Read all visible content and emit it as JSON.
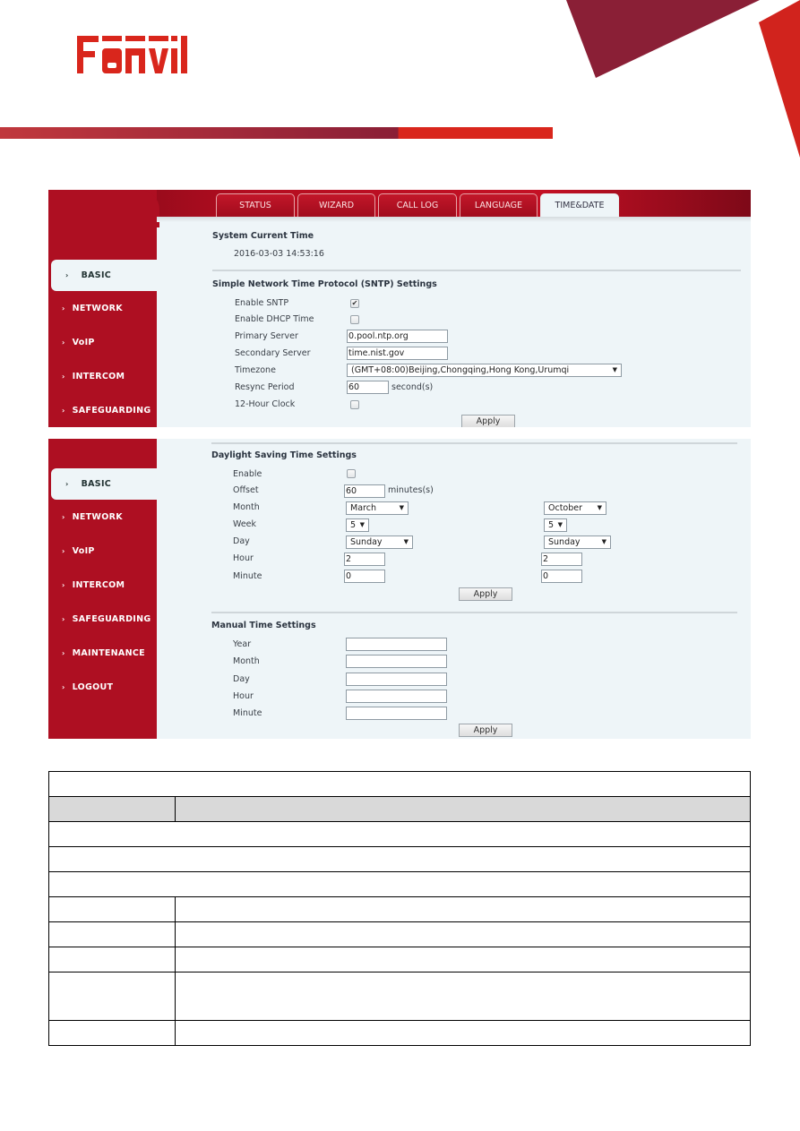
{
  "brand": {
    "logo_text": "Fanvil",
    "accent_red": "#d9261c",
    "accent_wine": "#8a1f36",
    "ui_red": "#ae0f22"
  },
  "panel1": {
    "tabs": [
      {
        "label": "STATUS",
        "active": false
      },
      {
        "label": "WIZARD",
        "active": false
      },
      {
        "label": "CALL LOG",
        "active": false
      },
      {
        "label": "LANGUAGE",
        "active": false
      },
      {
        "label": "TIME&DATE",
        "active": true
      }
    ],
    "nav": [
      {
        "label": "BASIC",
        "active": true
      },
      {
        "label": "NETWORK",
        "active": false
      },
      {
        "label": "VoIP",
        "active": false
      },
      {
        "label": "INTERCOM",
        "active": false
      },
      {
        "label": "SAFEGUARDING",
        "active": false
      }
    ],
    "system_time": {
      "title": "System Current Time",
      "value": "2016-03-03 14:53:16"
    },
    "sntp": {
      "title": "Simple Network Time Protocol (SNTP) Settings",
      "enable_sntp": {
        "label": "Enable SNTP",
        "checked": true
      },
      "enable_dhcp": {
        "label": "Enable DHCP Time",
        "checked": false
      },
      "primary": {
        "label": "Primary Server",
        "value": "0.pool.ntp.org"
      },
      "secondary": {
        "label": "Secondary Server",
        "value": "time.nist.gov"
      },
      "timezone": {
        "label": "Timezone",
        "value": "(GMT+08:00)Beijing,Chongqing,Hong Kong,Urumqi"
      },
      "resync": {
        "label": "Resync Period",
        "value": "60",
        "unit": "second(s)"
      },
      "clock12": {
        "label": "12-Hour Clock",
        "checked": false
      },
      "apply": "Apply"
    }
  },
  "panel2": {
    "nav": [
      {
        "label": "BASIC",
        "active": true
      },
      {
        "label": "NETWORK",
        "active": false
      },
      {
        "label": "VoIP",
        "active": false
      },
      {
        "label": "INTERCOM",
        "active": false
      },
      {
        "label": "SAFEGUARDING",
        "active": false
      },
      {
        "label": "MAINTENANCE",
        "active": false
      },
      {
        "label": "LOGOUT",
        "active": false
      }
    ],
    "dst": {
      "title": "Daylight Saving Time Settings",
      "enable": {
        "label": "Enable",
        "checked": false
      },
      "offset": {
        "label": "Offset",
        "value": "60",
        "unit": "minutes(s)"
      },
      "month": {
        "label": "Month",
        "start": "March",
        "end": "October"
      },
      "week": {
        "label": "Week",
        "start": "5",
        "end": "5"
      },
      "day": {
        "label": "Day",
        "start": "Sunday",
        "end": "Sunday"
      },
      "hour": {
        "label": "Hour",
        "start": "2",
        "end": "2"
      },
      "minute": {
        "label": "Minute",
        "start": "0",
        "end": "0"
      },
      "apply": "Apply"
    },
    "manual": {
      "title": "Manual Time Settings",
      "fields": [
        {
          "label": "Year",
          "value": ""
        },
        {
          "label": "Month",
          "value": ""
        },
        {
          "label": "Day",
          "value": ""
        },
        {
          "label": "Hour",
          "value": ""
        },
        {
          "label": "Minute",
          "value": ""
        }
      ],
      "apply": "Apply"
    }
  },
  "table": {
    "rows": [
      {
        "type": "full",
        "cells": [
          ""
        ]
      },
      {
        "type": "head",
        "cells": [
          "",
          ""
        ]
      },
      {
        "type": "full",
        "cells": [
          ""
        ]
      },
      {
        "type": "full",
        "cells": [
          ""
        ]
      },
      {
        "type": "full",
        "cells": [
          ""
        ]
      },
      {
        "type": "pair",
        "cells": [
          "",
          ""
        ]
      },
      {
        "type": "pair",
        "cells": [
          "",
          ""
        ]
      },
      {
        "type": "pair",
        "cells": [
          "",
          ""
        ]
      },
      {
        "type": "pair-tall",
        "cells": [
          "",
          ""
        ]
      },
      {
        "type": "pair",
        "cells": [
          "",
          ""
        ]
      }
    ]
  }
}
